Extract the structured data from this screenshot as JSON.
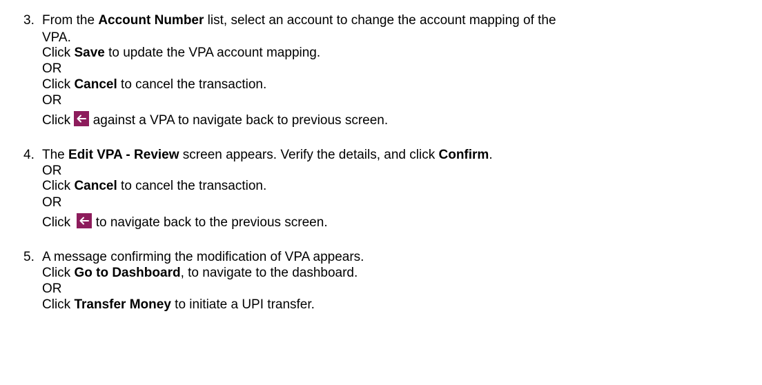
{
  "steps": [
    {
      "number": "3.",
      "line1": {
        "pre": "From the ",
        "bold": "Account Number",
        "post": " list, select an account to change the account mapping of the"
      },
      "line2": "VPA.",
      "save": {
        "pre": "Click ",
        "bold": "Save",
        "post": " to update the VPA account mapping."
      },
      "or1": "OR",
      "cancel": {
        "pre": "Click ",
        "bold": "Cancel",
        "post": " to cancel the transaction."
      },
      "or2": "OR",
      "back": {
        "pre": "Click ",
        "post": " against a VPA to navigate back to previous screen."
      }
    },
    {
      "number": "4.",
      "line1": {
        "pre": "The ",
        "bold": "Edit VPA - Review",
        "mid": " screen appears. Verify the details, and click ",
        "bold2": "Confirm",
        "post": "."
      },
      "or1": "OR",
      "cancel": {
        "pre": "Click ",
        "bold": "Cancel",
        "post": " to cancel the transaction."
      },
      "or2": "OR",
      "back": {
        "pre": "Click ",
        "post": " to navigate back to the previous screen."
      }
    },
    {
      "number": "5.",
      "line1": "A message confirming the modification of VPA appears.",
      "dashboard": {
        "pre": "Click ",
        "bold": "Go to Dashboard",
        "post": ", to navigate to the dashboard."
      },
      "or1": "OR",
      "transfer": {
        "pre": "Click ",
        "bold": "Transfer Money",
        "post": " to initiate a UPI transfer."
      }
    }
  ],
  "icons": {
    "back_icon": "arrow-left-icon",
    "back_icon_color": "#8d1c5c"
  }
}
